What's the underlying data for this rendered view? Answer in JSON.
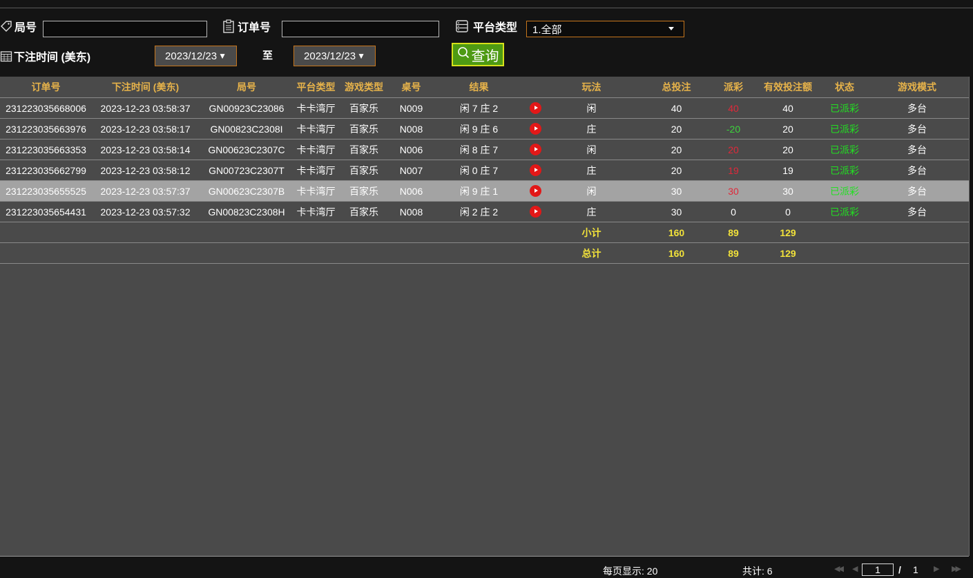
{
  "filters": {
    "round_label": "局号",
    "round_value": "",
    "order_label": "订单号",
    "order_value": "",
    "platform_label": "平台类型",
    "platform_selected": "1.全部",
    "time_label": "下注时间 (美东)",
    "date_from": "2023/12/23",
    "date_to": "2023/12/23",
    "to_label": "至",
    "query_label": "查询"
  },
  "table": {
    "headers": [
      "订单号",
      "下注时间 (美东)",
      "局号",
      "平台类型",
      "游戏类型",
      "桌号",
      "结果",
      "",
      "玩法",
      "总投注",
      "派彩",
      "有效投注额",
      "状态",
      "游戏模式"
    ],
    "rows": [
      {
        "order": "231223035668006",
        "time": "2023-12-23 03:58:37",
        "round": "GN00923C23086",
        "platform": "卡卡湾厅",
        "game": "百家乐",
        "table": "N009",
        "result": "闲 7 庄 2",
        "play": "闲",
        "bet": "40",
        "payout": "40",
        "valid": "40",
        "status": "已派彩",
        "mode": "多台"
      },
      {
        "order": "231223035663976",
        "time": "2023-12-23 03:58:17",
        "round": "GN00823C2308I",
        "platform": "卡卡湾厅",
        "game": "百家乐",
        "table": "N008",
        "result": "闲 9 庄 6",
        "play": "庄",
        "bet": "20",
        "payout": "-20",
        "valid": "20",
        "status": "已派彩",
        "mode": "多台"
      },
      {
        "order": "231223035663353",
        "time": "2023-12-23 03:58:14",
        "round": "GN00623C2307C",
        "platform": "卡卡湾厅",
        "game": "百家乐",
        "table": "N006",
        "result": "闲 8 庄 7",
        "play": "闲",
        "bet": "20",
        "payout": "20",
        "valid": "20",
        "status": "已派彩",
        "mode": "多台"
      },
      {
        "order": "231223035662799",
        "time": "2023-12-23 03:58:12",
        "round": "GN00723C2307T",
        "platform": "卡卡湾厅",
        "game": "百家乐",
        "table": "N007",
        "result": "闲 0 庄 7",
        "play": "庄",
        "bet": "20",
        "payout": "19",
        "valid": "19",
        "status": "已派彩",
        "mode": "多台"
      },
      {
        "order": "231223035655525",
        "time": "2023-12-23 03:57:37",
        "round": "GN00623C2307B",
        "platform": "卡卡湾厅",
        "game": "百家乐",
        "table": "N006",
        "result": "闲 9 庄 1",
        "play": "闲",
        "bet": "30",
        "payout": "30",
        "valid": "30",
        "status": "已派彩",
        "mode": "多台"
      },
      {
        "order": "231223035654431",
        "time": "2023-12-23 03:57:32",
        "round": "GN00823C2308H",
        "platform": "卡卡湾厅",
        "game": "百家乐",
        "table": "N008",
        "result": "闲 2 庄 2",
        "play": "庄",
        "bet": "30",
        "payout": "0",
        "valid": "0",
        "status": "已派彩",
        "mode": "多台"
      }
    ],
    "subtotal": {
      "label": "小计",
      "bet": "160",
      "payout": "89",
      "valid": "129"
    },
    "total": {
      "label": "总计",
      "bet": "160",
      "payout": "89",
      "valid": "129"
    }
  },
  "footer": {
    "per_page": "每页显示: 20",
    "count": "共计: 6",
    "page_current": "1",
    "page_sep": "/",
    "page_total": "1"
  },
  "colors": {
    "header_text": "#e7b34a",
    "negative_or_win": "#e0283a",
    "loss_green": "#3cd43c",
    "status_green": "#22e022",
    "summary_yellow": "#f2e23a",
    "accent_border": "#c7761c",
    "query_button": "#4e9a13"
  },
  "icons": [
    "tag-icon",
    "clipboard-icon",
    "server-icon",
    "calendar-icon",
    "search-icon",
    "play-icon"
  ]
}
